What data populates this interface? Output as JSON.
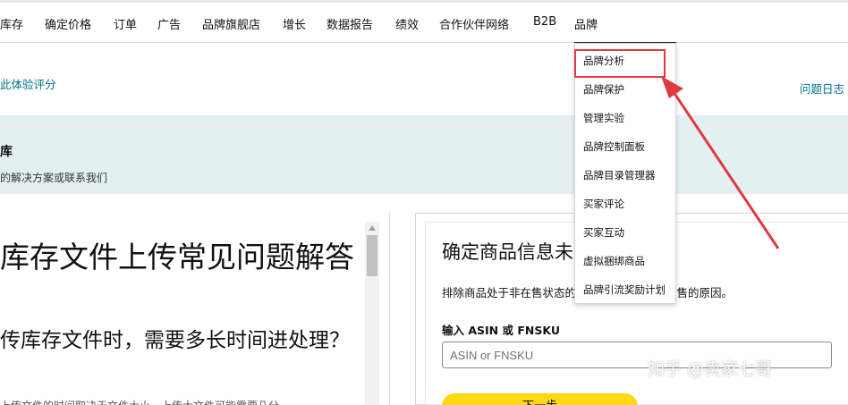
{
  "nav": {
    "items": [
      "库存",
      "确定价格",
      "订单",
      "广告",
      "品牌旗舰店",
      "增长",
      "数据报告",
      "绩效",
      "合作伙伴网络",
      "B2B",
      "品牌"
    ]
  },
  "subheader": {
    "left_link": "此体验评分",
    "right_link": "问题日志"
  },
  "banner": {
    "title": "库",
    "text": "的解决方案或联系我们"
  },
  "left_panel": {
    "heading": "库存文件上传常见问题解答",
    "subheading": "传库存文件时，需要多长时间进处理？",
    "body": "上传文件的时间取决于文件大小，上传大文件可能需要几分"
  },
  "right_panel": {
    "title": "确定商品信息未在售的原因",
    "description": "排除商品处于非在售状态的原因并确定商品非在售的原因。",
    "input_label": "输入 ASIN 或 FNSKU",
    "input_placeholder": "ASIN or FNSKU",
    "button_label": "下一步"
  },
  "dropdown": {
    "items": [
      "品牌分析",
      "品牌保护",
      "管理实验",
      "品牌控制面板",
      "品牌目录管理器",
      "买家评论",
      "买家互动",
      "虚拟捆绑商品",
      "品牌引流奖励计划"
    ]
  },
  "annotation": {
    "color": "#e0393e"
  },
  "watermark": {
    "text": "知乎 @卖家七哥"
  }
}
